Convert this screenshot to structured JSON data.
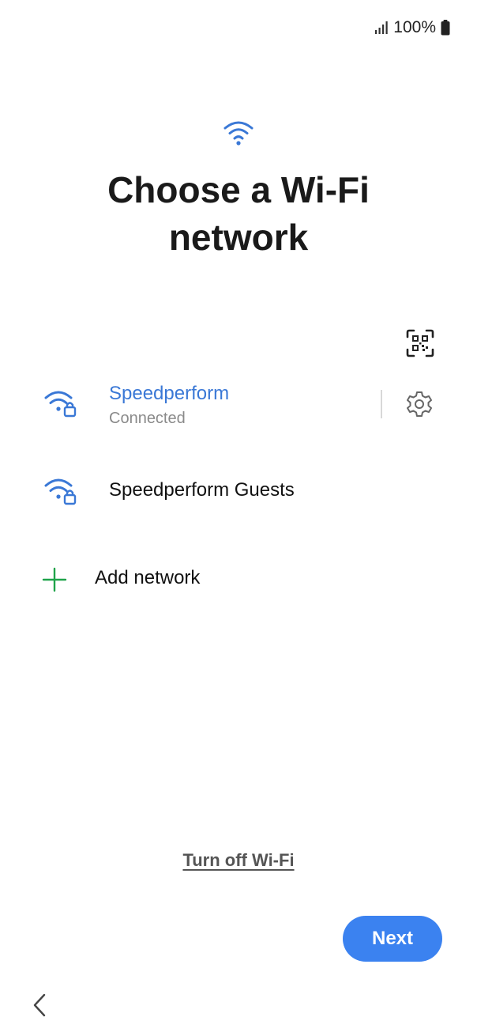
{
  "status_bar": {
    "signal_icon": "signal-icon",
    "battery_text": "100%",
    "battery_icon": "battery-icon"
  },
  "header": {
    "icon": "wifi-icon",
    "title_line1": "Choose a Wi-Fi",
    "title_line2": "network"
  },
  "qr_scan": {
    "icon": "qr-code-scan-icon"
  },
  "networks": [
    {
      "name": "Speedperform",
      "status": "Connected",
      "icon": "wifi-lock-icon",
      "connected": true
    },
    {
      "name": "Speedperform Guests",
      "status": "",
      "icon": "wifi-lock-icon",
      "connected": false
    }
  ],
  "add_network": {
    "label": "Add network",
    "icon": "plus-icon"
  },
  "footer": {
    "turn_off_label": "Turn off Wi-Fi",
    "next_label": "Next",
    "back_icon": "chevron-left-icon"
  },
  "colors": {
    "accent": "#3b82f0",
    "connected_text": "#3a78d6",
    "wifi_icon": "#3a78d6",
    "plus": "#1fa34a"
  }
}
